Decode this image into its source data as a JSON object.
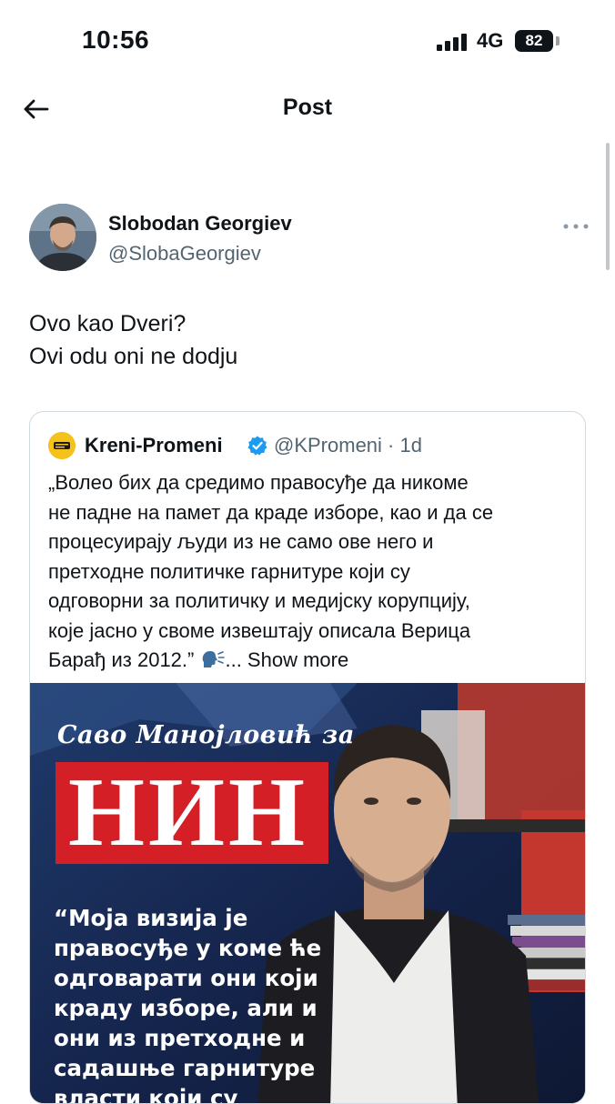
{
  "status_bar": {
    "time": "10:56",
    "network": "4G",
    "battery": "82"
  },
  "header": {
    "title": "Post",
    "back_icon": "arrow-left-icon"
  },
  "post": {
    "author": {
      "display_name": "Slobodan Georgiev",
      "handle": "@SlobaGeorgiev"
    },
    "more_icon": "more-horizontal-icon",
    "text_lines": [
      "Ovo kao Dveri?",
      "Ovi odu oni ne dodju"
    ]
  },
  "quoted_post": {
    "author_name": "Kreni-Promeni",
    "verified": true,
    "handle_time": "@KPromeni · 1d",
    "body_lines": [
      "„Волео бих да средимо правосуђе да никоме",
      "не падне на памет да краде изборе, као и да се",
      "процесуирају људи из не само ове него и",
      "претходне политичке гарнитуре који су",
      "одговорни за политичку и медијску корупцију,",
      "које јасно у своме извештају описала Верица",
      "Барађ из 2012.” "
    ],
    "emoji": "speaking-head-icon",
    "show_more": "... Show more",
    "media": {
      "title": "Саво Манојловић за",
      "masthead": "НИН",
      "quote_lines": [
        "“Моја визија је",
        "правосуђе у коме ће",
        "одговарати они који",
        "краду изборе, али и",
        "они из претходне и",
        "садашње гарнитуре",
        "власти који су"
      ]
    }
  },
  "colors": {
    "text": "#0f1419",
    "secondary": "#536471",
    "verified": "#1d9bf0",
    "nin_red": "#d51f27",
    "card_border": "#cfd9de"
  }
}
